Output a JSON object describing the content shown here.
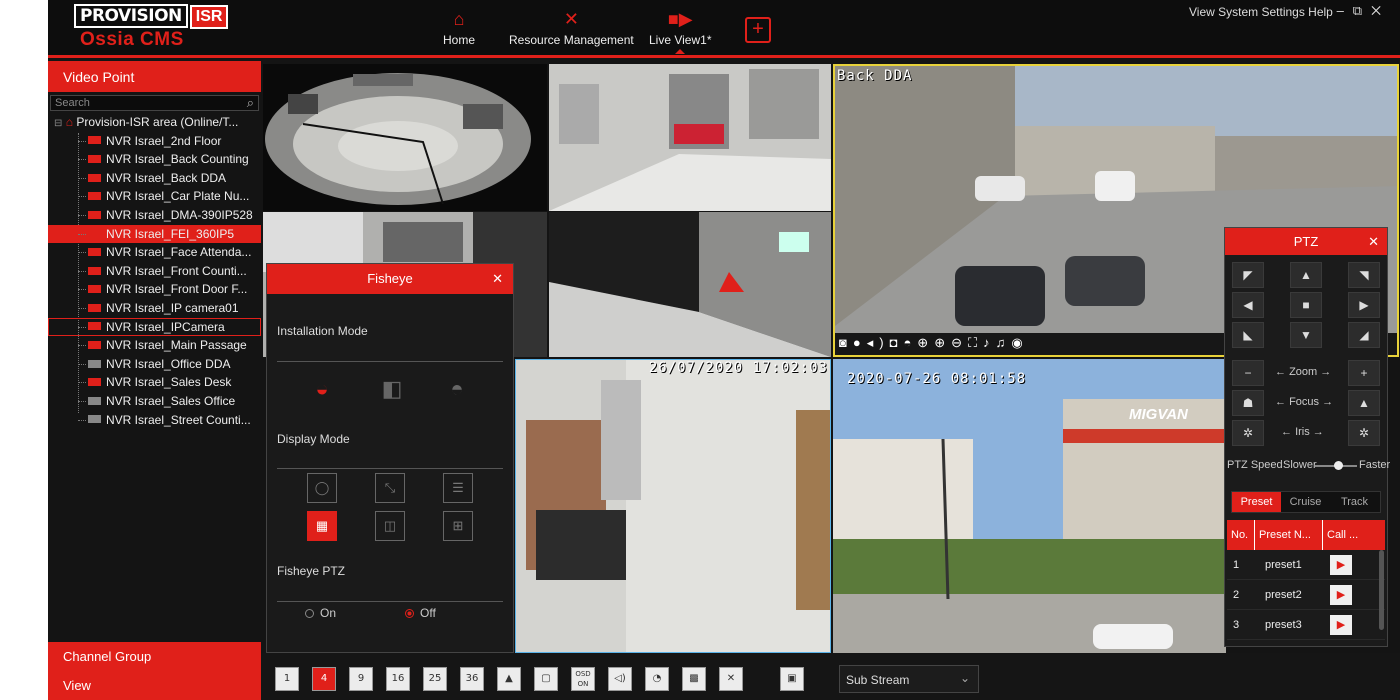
{
  "header": {
    "logo_brand": "PROVISION",
    "logo_isr": "ISR",
    "logo_product": "Ossia CMS",
    "nav": [
      {
        "label": "Home",
        "icon": "home-icon"
      },
      {
        "label": "Resource Management",
        "icon": "tools-icon"
      },
      {
        "label": "Live View1*",
        "icon": "camera-icon"
      }
    ],
    "add_tab": "+",
    "system_menu": "View System Settings Help",
    "window_controls": [
      "–",
      "⧉",
      "✕"
    ]
  },
  "left_panel": {
    "title": "Video Point",
    "search_placeholder": "Search",
    "root": "Provision-ISR area (Online/T...",
    "devices": [
      {
        "label": "NVR Israel_2nd Floor",
        "online": true
      },
      {
        "label": "NVR Israel_Back Counting",
        "online": true
      },
      {
        "label": "NVR Israel_Back DDA",
        "online": true
      },
      {
        "label": "NVR Israel_Car Plate Nu...",
        "online": true
      },
      {
        "label": "NVR Israel_DMA-390IP528",
        "online": true
      },
      {
        "label": "NVR Israel_FEI_360IP5",
        "online": true,
        "selected": true
      },
      {
        "label": "NVR Israel_Face Attenda...",
        "online": true
      },
      {
        "label": "NVR Israel_Front Counti...",
        "online": true
      },
      {
        "label": "NVR Israel_Front Door F...",
        "online": true
      },
      {
        "label": "NVR Israel_IP camera01",
        "online": true
      },
      {
        "label": "NVR Israel_IPCamera",
        "online": true,
        "outlined": true
      },
      {
        "label": "NVR Israel_Main Passage",
        "online": true
      },
      {
        "label": "NVR Israel_Office DDA",
        "online": false
      },
      {
        "label": "NVR Israel_Sales Desk",
        "online": true
      },
      {
        "label": "NVR Israel_Sales Office",
        "online": false
      },
      {
        "label": "NVR Israel_Street Counti...",
        "online": false
      }
    ],
    "channel_group": "Channel Group",
    "view": "View"
  },
  "video": {
    "back_dda_title": "Back DDA",
    "timestamp_fisheye": "26/07/2020 17:02:03",
    "timestamp_street": "2020-07-26 08:01:58",
    "migvan_sign": "MIGVAN"
  },
  "fisheye": {
    "title": "Fisheye",
    "close": "✕",
    "installation_mode": "Installation Mode",
    "display_mode": "Display Mode",
    "fisheye_ptz": "Fisheye PTZ",
    "ptz_on": "On",
    "ptz_off": "Off",
    "ptz_selected": "Off"
  },
  "ptz": {
    "title": "PTZ",
    "close": "✕",
    "zoom": "Zoom",
    "focus": "Focus",
    "iris": "Iris",
    "speed_label": "PTZ Speed",
    "slower": "Slower",
    "faster": "Faster",
    "speed_level": 0.55,
    "tabs": [
      "Preset",
      "Cruise",
      "Track"
    ],
    "table_headers": [
      "No.",
      "Preset N...",
      "Call ..."
    ],
    "presets": [
      {
        "no": "1",
        "name": "preset1"
      },
      {
        "no": "2",
        "name": "preset2"
      },
      {
        "no": "3",
        "name": "preset3"
      }
    ]
  },
  "toolbar": {
    "layouts": [
      "1",
      "4",
      "9",
      "16",
      "25",
      "36"
    ],
    "active_layout": "4",
    "osd_label": "OSD ON",
    "stream": "Sub Stream"
  },
  "colors": {
    "accent": "#e0201a",
    "background": "#141414",
    "ptz_highlight": "#e8d23a"
  }
}
